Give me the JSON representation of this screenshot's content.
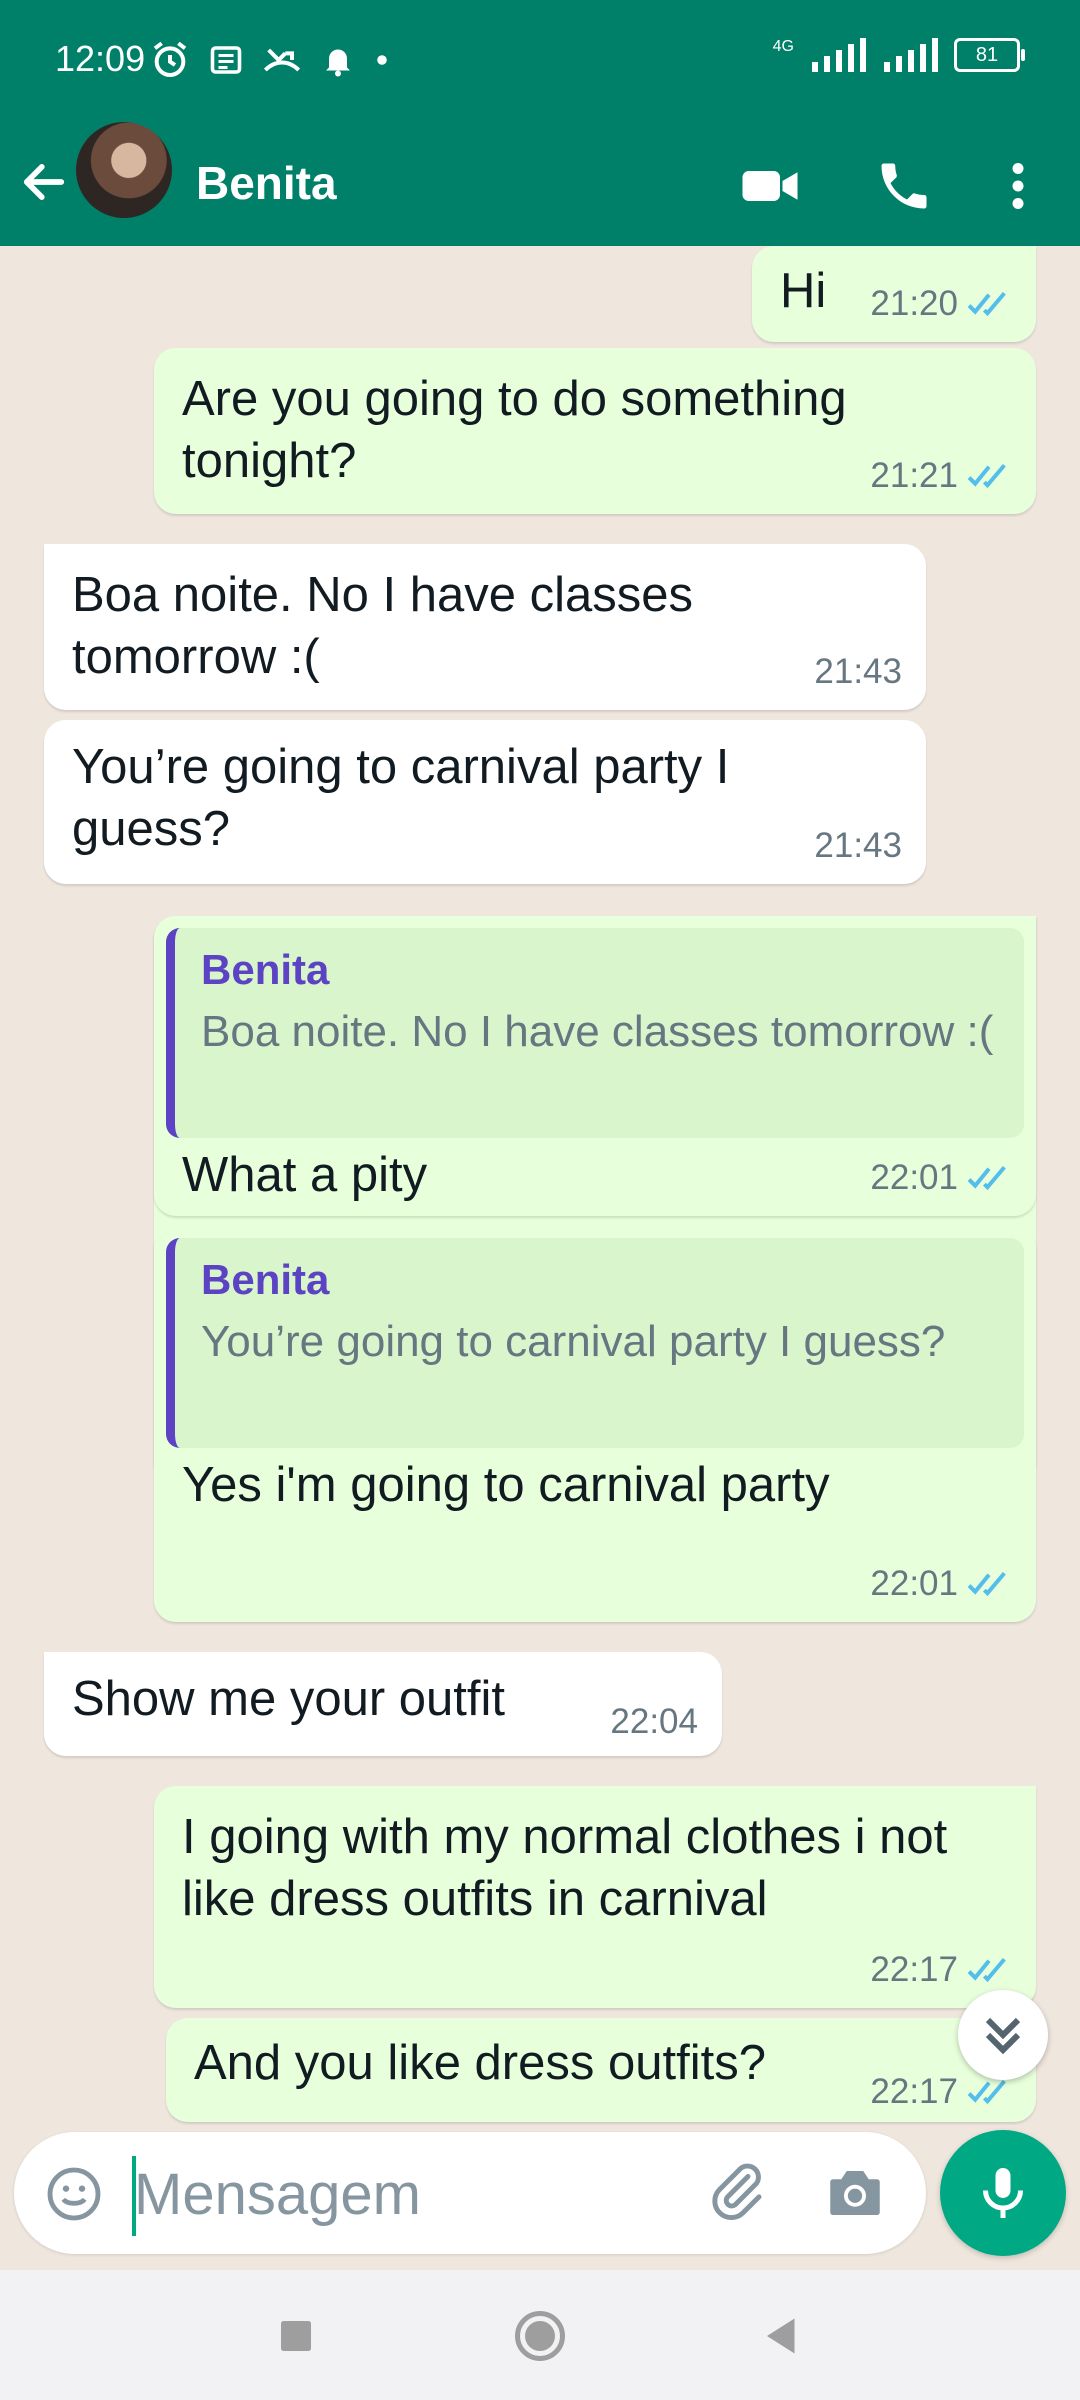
{
  "status_bar": {
    "time": "12:09",
    "network": "4G",
    "battery": "81"
  },
  "header": {
    "contact_name": "Benita",
    "icons": [
      "back-arrow-icon",
      "video-call-icon",
      "phone-icon",
      "more-vert-icon"
    ]
  },
  "messages": [
    {
      "dir": "out",
      "text": "Hi",
      "time": "21:20",
      "status": "read"
    },
    {
      "dir": "out",
      "text": "Are you going to do something tonight?",
      "time": "21:21",
      "status": "read"
    },
    {
      "dir": "in",
      "text": "Boa noite. No I have classes tomorrow :(",
      "time": "21:43"
    },
    {
      "dir": "in",
      "text": "You’re going to carnival party I guess?",
      "time": "21:43"
    },
    {
      "dir": "out",
      "quote_author": "Benita",
      "quote_text": "Boa noite. No I have classes tomorrow :(",
      "text": "What a pity",
      "time": "22:01",
      "status": "read"
    },
    {
      "dir": "out",
      "quote_author": "Benita",
      "quote_text": "You’re going to carnival party I guess?",
      "text": "Yes i'm going to carnival party",
      "time": "22:01",
      "status": "read"
    },
    {
      "dir": "in",
      "text": "Show me your outfit",
      "time": "22:04"
    },
    {
      "dir": "out",
      "text": "I going with my normal clothes i not like dress outfits in carnival",
      "time": "22:17",
      "status": "read"
    },
    {
      "dir": "out",
      "text": "And you like dress outfits?",
      "time": "22:17",
      "status": "read"
    }
  ],
  "composer": {
    "placeholder": "Mensagem",
    "icons": [
      "emoji-icon",
      "attach-icon",
      "camera-icon",
      "mic-icon"
    ]
  },
  "colors": {
    "brand": "#008069",
    "accent": "#00a884",
    "outgoing_bubble": "#e7ffdb",
    "incoming_bubble": "#ffffff",
    "read_ticks": "#53bdeb",
    "quote_author": "#5b43c4"
  }
}
